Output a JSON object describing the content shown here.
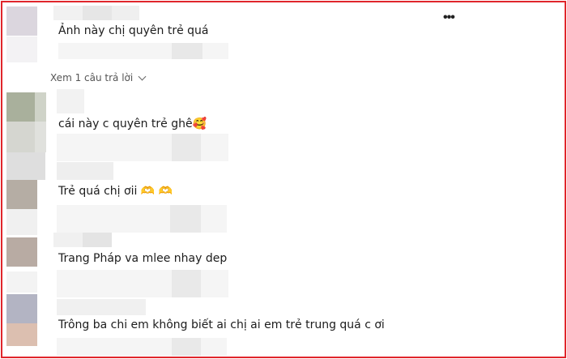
{
  "comments": [
    {
      "text": "Ảnh này chị quyên trẻ quá"
    },
    {
      "text": "cái này c quyên trẻ ghê",
      "emoji": "🥰"
    },
    {
      "text": "Trẻ quá chị ơii",
      "emoji": "🫶 🫶"
    },
    {
      "text": "Trang Pháp va mlee nhay dep"
    },
    {
      "text": "Trông ba chi em không biết ai chị ai em trẻ trung quá c ơi"
    }
  ],
  "view_replies": {
    "label": "Xem 1 câu trả lời"
  },
  "icons": {
    "more": "more-options-icon",
    "chevron": "chevron-down-icon"
  }
}
